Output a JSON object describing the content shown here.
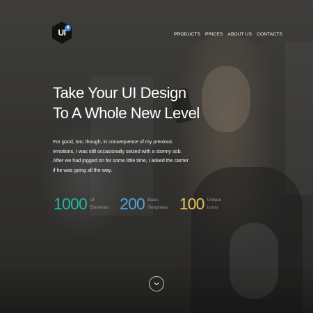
{
  "logo": {
    "text": "UI",
    "badge": "8"
  },
  "nav": {
    "items": [
      {
        "label": "PRODUCTS"
      },
      {
        "label": "PRICES"
      },
      {
        "label": "ABOUT US"
      },
      {
        "label": "CONTACTS"
      }
    ]
  },
  "hero": {
    "headline_line1": "Take Your UI Design",
    "headline_line2": "To A Whole New Level",
    "body": "For good, too; though, in consequence of my previous emotions, I was still occasionally seized with a stormy sob. After we had jogged on for some little time, I asked the carrier if he was going all the way."
  },
  "stats": [
    {
      "number": "1000",
      "label_line1": "UI",
      "label_line2": "Elements",
      "color": "#1fb6a3"
    },
    {
      "number": "200",
      "label_line1": "Basic",
      "label_line2": "Templates",
      "color": "#4ea8d8"
    },
    {
      "number": "100",
      "label_line1": "Unique",
      "label_line2": "Icons",
      "color": "#e8c35a"
    }
  ],
  "scroll": {
    "icon": "chevron-down-icon"
  },
  "colors": {
    "text": "#ffffff",
    "logo_badge": "#3a8fd8"
  }
}
